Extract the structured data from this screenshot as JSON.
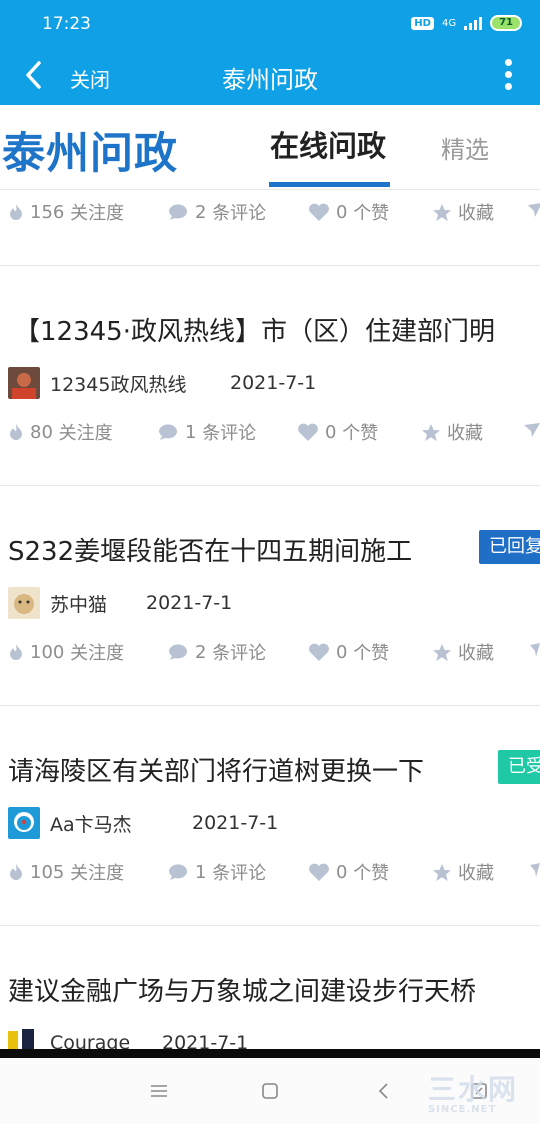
{
  "status_bar": {
    "time": "17:23",
    "hd": "HD",
    "network": "4G",
    "battery": "71"
  },
  "app_bar": {
    "close_label": "关闭",
    "title": "泰州问政"
  },
  "header": {
    "logo_text": "泰州问政",
    "tabs": [
      {
        "label": "在线问政",
        "active": true
      },
      {
        "label": "精选",
        "active": false
      }
    ]
  },
  "stat_labels": {
    "follow_suffix": "关注度",
    "comment_suffix": "条评论",
    "like_suffix": "个赞",
    "favorite": "收藏"
  },
  "top_stats": {
    "follows": "156",
    "comments": "2",
    "likes": "0"
  },
  "posts": [
    {
      "title": "【12345·政风热线】市（区）住建部门明",
      "author": "12345政风热线",
      "date": "2021-7-1",
      "follows": "80",
      "comments": "1",
      "likes": "0"
    },
    {
      "title": "S232姜堰段能否在十四五期间施工",
      "badge": "已回复",
      "badge_color": "#1f6fc6",
      "author": "苏中猫",
      "date": "2021-7-1",
      "follows": "100",
      "comments": "2",
      "likes": "0"
    },
    {
      "title": "请海陵区有关部门将行道树更换一下",
      "badge": "已受理",
      "badge_color": "#1fc9a6",
      "author": "Aa卞马杰",
      "date": "2021-7-1",
      "follows": "105",
      "comments": "1",
      "likes": "0"
    },
    {
      "title": "建议金融广场与万象城之间建设步行天桥",
      "author": "Courage",
      "date": "2021-7-1"
    }
  ],
  "watermark": {
    "text": "三水网",
    "sub": "SINCE.NET"
  },
  "colors": {
    "appbar": "#0fa0e6",
    "brand": "#1d74c9"
  }
}
